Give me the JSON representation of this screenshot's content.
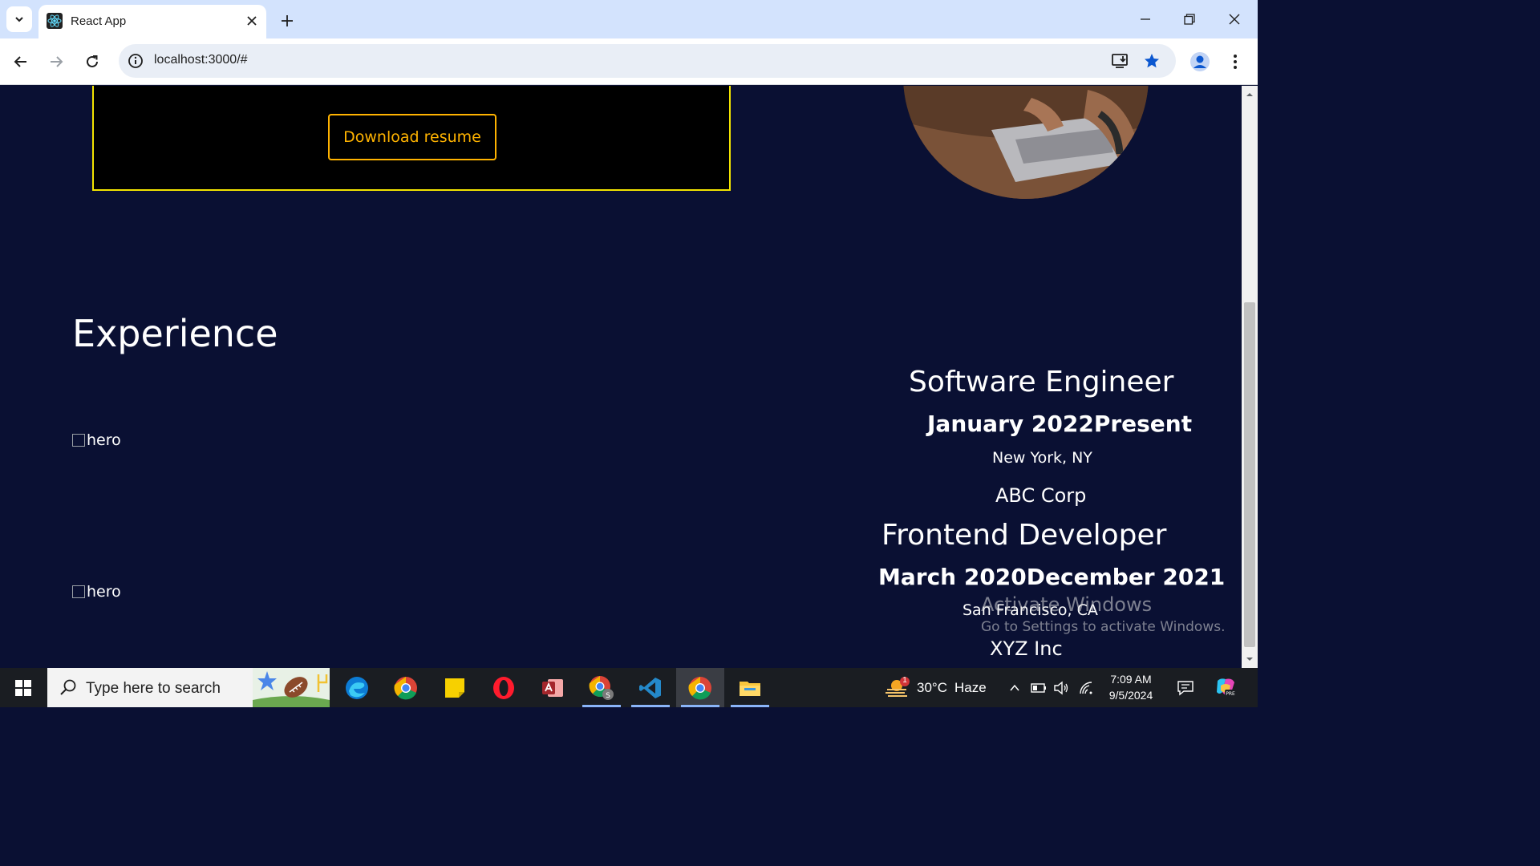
{
  "browser": {
    "tab_title": "React App",
    "url": "localhost:3000/#"
  },
  "page": {
    "download_button": "Download resume",
    "section_heading": "Experience",
    "image_alt": "hero",
    "experiences": [
      {
        "title": "Software Engineer",
        "dates": "January 2022Present",
        "location": "New York, NY",
        "company": "ABC Corp"
      },
      {
        "title": "Frontend Developer",
        "dates": "March 2020December 2021",
        "location": "San Francisco, CA",
        "company": "XYZ Inc"
      }
    ]
  },
  "watermark": {
    "line1": "Activate Windows",
    "line2": "Go to Settings to activate Windows."
  },
  "taskbar": {
    "search_placeholder": "Type here to search",
    "weather_temp": "30°C",
    "weather_desc": "Haze",
    "weather_badge": "1",
    "time": "7:09 AM",
    "date": "9/5/2024"
  },
  "colors": {
    "page_bg": "#0a1033",
    "hero_border": "#f2e300",
    "button_accent": "#ffb300",
    "tabstrip_bg": "#d3e3fd"
  }
}
